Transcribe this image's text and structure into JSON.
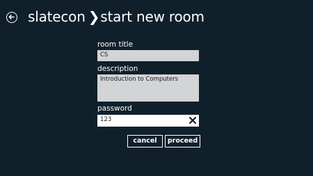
{
  "header": {
    "app_name": "slatecon",
    "separator": "❯",
    "page_title": "start new room"
  },
  "form": {
    "room_title_label": "room title",
    "room_title_value": "CS",
    "description_label": "description",
    "description_value": "Introduction to Computers",
    "password_label": "password",
    "password_value": "123"
  },
  "actions": {
    "cancel_label": "cancel",
    "proceed_label": "proceed"
  },
  "icons": {
    "back": "arrow-left-circle-icon",
    "clear": "close-icon"
  },
  "colors": {
    "background": "#0f202a",
    "field_inactive": "#d2d4d6",
    "field_active": "#ffffff",
    "text": "#ffffff"
  }
}
